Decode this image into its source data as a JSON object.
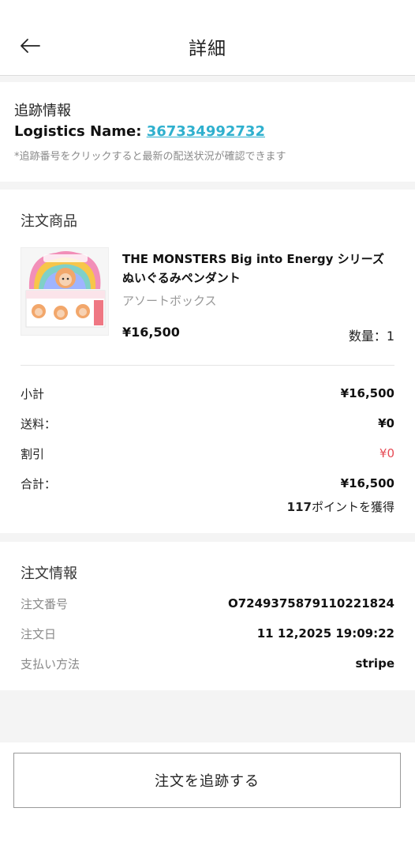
{
  "header": {
    "title": "詳細"
  },
  "tracking": {
    "title": "追跡情報",
    "logistics_label": "Logistics Name:",
    "tracking_number": "367334992732",
    "note": "*追跡番号をクリックすると最新の配送状況が確認できます"
  },
  "products": {
    "title": "注文商品",
    "item": {
      "name": "THE MONSTERS Big into Energy シリーズ ぬいぐるみペンダント",
      "variant": "アソートボックス",
      "price": "¥16,500",
      "quantity": "数量：1"
    },
    "summary": {
      "subtotal_label": "小計",
      "subtotal": "¥16,500",
      "shipping_label": "送料：",
      "shipping": "¥0",
      "discount_label": "割引",
      "discount": "¥0",
      "total_label": "合計：",
      "total": "¥16,500",
      "points_value": "117",
      "points_suffix": "ポイントを獲得"
    }
  },
  "order_info": {
    "title": "注文情報",
    "order_no_label": "注文番号",
    "order_no": "O7249375879110221824",
    "date_label": "注文日",
    "date": "11 12,2025 19:09:22",
    "payment_label": "支払い方法",
    "payment": "stripe"
  },
  "footer": {
    "track_button": "注文を追跡する"
  },
  "colors": {
    "link": "#2fb0ce",
    "discount": "#e64b55"
  }
}
